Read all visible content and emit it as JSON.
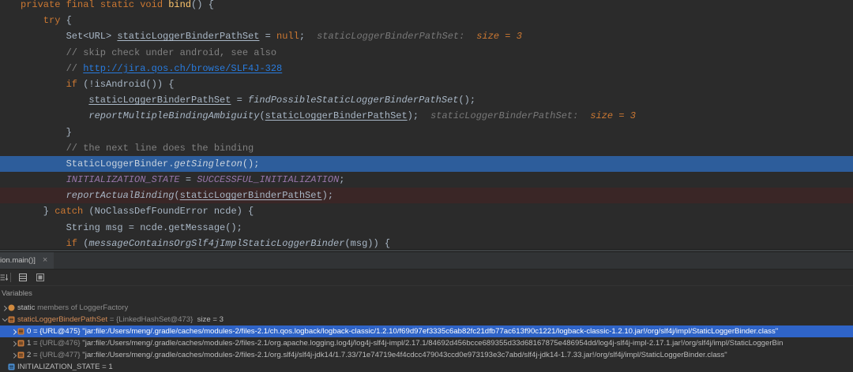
{
  "theme": {
    "editor_bg": "#2b2b2b",
    "execution_line_bg": "#2d5d9b",
    "breakpoint_line_bg": "#3a2626",
    "panel_bg": "#2b2b2b",
    "tabbar_bg": "#313335",
    "selection_bg": "#2f64c8"
  },
  "editor": {
    "lines": [
      {
        "indent": 0,
        "segs": [
          {
            "t": "private final static void ",
            "color": "#cc7832"
          },
          {
            "t": "bind",
            "color": "#ffc66d"
          },
          {
            "t": "() {",
            "color": "#a9b7c6"
          }
        ]
      },
      {
        "indent": 1,
        "segs": [
          {
            "t": "try",
            "color": "#cc7832"
          },
          {
            "t": " {",
            "color": "#a9b7c6"
          }
        ]
      },
      {
        "indent": 2,
        "segs": [
          {
            "t": "Set<URL> ",
            "color": "#a9b7c6"
          },
          {
            "t": "staticLoggerBinderPathSet",
            "color": "#a9b7c6",
            "underline": true
          },
          {
            "t": " = ",
            "color": "#a9b7c6"
          },
          {
            "t": "null",
            "color": "#cc7832"
          },
          {
            "t": ";",
            "color": "#a9b7c6"
          },
          {
            "t": "staticLoggerBinderPathSet:",
            "color": "#787878",
            "italic": true,
            "hint": true
          },
          {
            "t": "size = 3",
            "color": "#cc7832",
            "italic": true,
            "hint": true
          }
        ]
      },
      {
        "indent": 2,
        "segs": [
          {
            "t": "// skip check under android, see also",
            "color": "#808080"
          }
        ]
      },
      {
        "indent": 2,
        "segs": [
          {
            "t": "// ",
            "color": "#808080"
          },
          {
            "t": "http://jira.qos.ch/browse/SLF4J-328",
            "color": "#287bde",
            "underline": true,
            "link": true
          }
        ]
      },
      {
        "indent": 2,
        "segs": [
          {
            "t": "if",
            "color": "#cc7832"
          },
          {
            "t": " (!isAndroid()) {",
            "color": "#a9b7c6"
          }
        ]
      },
      {
        "indent": 3,
        "segs": [
          {
            "t": "staticLoggerBinderPathSet",
            "color": "#a9b7c6",
            "underline": true
          },
          {
            "t": " = ",
            "color": "#a9b7c6"
          },
          {
            "t": "findPossibleStaticLoggerBinderPathSet",
            "color": "#a9b7c6",
            "italic": true
          },
          {
            "t": "();",
            "color": "#a9b7c6"
          }
        ]
      },
      {
        "indent": 3,
        "segs": [
          {
            "t": "reportMultipleBindingAmbiguity",
            "color": "#a9b7c6",
            "italic": true
          },
          {
            "t": "(",
            "color": "#a9b7c6"
          },
          {
            "t": "staticLoggerBinderPathSet",
            "color": "#a9b7c6",
            "underline": true
          },
          {
            "t": ");",
            "color": "#a9b7c6"
          },
          {
            "t": "staticLoggerBinderPathSet:",
            "color": "#787878",
            "italic": true,
            "hint": true
          },
          {
            "t": "size = 3",
            "color": "#cc7832",
            "italic": true,
            "hint": true
          }
        ]
      },
      {
        "indent": 2,
        "segs": [
          {
            "t": "}",
            "color": "#a9b7c6"
          }
        ]
      },
      {
        "indent": 2,
        "segs": [
          {
            "t": "// the next line does the binding",
            "color": "#808080"
          }
        ]
      },
      {
        "indent": 2,
        "current_execution_line": true,
        "segs": [
          {
            "t": "StaticLoggerBinder.",
            "color": "#c9d3de"
          },
          {
            "t": "getSingleton",
            "color": "#c9d3de",
            "italic": true
          },
          {
            "t": "();",
            "color": "#c9d3de"
          }
        ]
      },
      {
        "indent": 2,
        "segs": [
          {
            "t": "INITIALIZATION_STATE",
            "color": "#9876aa",
            "italic": true
          },
          {
            "t": " = ",
            "color": "#a9b7c6"
          },
          {
            "t": "SUCCESSFUL_INITIALIZATION",
            "color": "#9876aa",
            "italic": true
          },
          {
            "t": ";",
            "color": "#a9b7c6"
          }
        ]
      },
      {
        "indent": 2,
        "breakpoint": true,
        "segs": [
          {
            "t": "reportActualBinding",
            "color": "#a9b7c6",
            "italic": true
          },
          {
            "t": "(",
            "color": "#a9b7c6"
          },
          {
            "t": "staticLoggerBinderPathSet",
            "color": "#a9b7c6",
            "underline": true
          },
          {
            "t": ");",
            "color": "#a9b7c6"
          }
        ]
      },
      {
        "indent": 1,
        "segs": [
          {
            "t": "} ",
            "color": "#a9b7c6"
          },
          {
            "t": "catch",
            "color": "#cc7832"
          },
          {
            "t": " (NoClassDefFoundError ncde) {",
            "color": "#a9b7c6"
          }
        ]
      },
      {
        "indent": 2,
        "segs": [
          {
            "t": "String msg = ncde.getMessage();",
            "color": "#a9b7c6"
          }
        ]
      },
      {
        "indent": 2,
        "segs": [
          {
            "t": "if",
            "color": "#cc7832"
          },
          {
            "t": " (",
            "color": "#a9b7c6"
          },
          {
            "t": "messageContainsOrgSlf4jImplStaticLoggerBinder",
            "color": "#a9b7c6",
            "italic": true
          },
          {
            "t": "(msg)) {",
            "color": "#a9b7c6"
          }
        ]
      }
    ]
  },
  "debugger": {
    "tab": {
      "label": "ion.main()]",
      "close": "×"
    },
    "toolbar_icons": [
      "restore-layout-icon",
      "table-view-icon",
      "panel-layout-icon"
    ],
    "variables_title": "Variables",
    "tree": [
      {
        "level": 0,
        "expandable": true,
        "expanded": false,
        "selected": false,
        "icon": "static-members-icon",
        "segs": [
          {
            "t": "static",
            "color": "#bbbbbb"
          },
          {
            "t": " members of LoggerFactory",
            "color": "#8c8c8c"
          }
        ]
      },
      {
        "level": 0,
        "expandable": true,
        "expanded": true,
        "selected": false,
        "icon": "field-icon",
        "segs": [
          {
            "t": "staticLoggerBinderPathSet",
            "color": "#d28b57"
          },
          {
            "t": " = {LinkedHashSet@473}",
            "color": "#8c8c8c"
          },
          {
            "t": "  size = 3",
            "color": "#bbbbbb"
          }
        ]
      },
      {
        "level": 1,
        "expandable": true,
        "expanded": false,
        "selected": true,
        "icon": "list-element-icon",
        "segs": [
          {
            "t": "0",
            "color": "#ffffff"
          },
          {
            "t": " = ",
            "color": "#ffffff"
          },
          {
            "t": "{URL@475} ",
            "color": "#ffffff"
          },
          {
            "t": "\"jar:file:/Users/meng/.gradle/caches/modules-2/files-2.1/ch.qos.logback/logback-classic/1.2.10/f69d97ef3335c6ab82fc21dfb77ac613f90c1221/logback-classic-1.2.10.jar!/org/slf4j/impl/StaticLoggerBinder.class\"",
            "color": "#ffffff"
          }
        ]
      },
      {
        "level": 1,
        "expandable": true,
        "expanded": false,
        "selected": false,
        "icon": "list-element-icon",
        "segs": [
          {
            "t": "1",
            "color": "#bbbbbb"
          },
          {
            "t": " = ",
            "color": "#bbbbbb"
          },
          {
            "t": "{URL@476} ",
            "color": "#8c8c8c"
          },
          {
            "t": "\"jar:file:/Users/meng/.gradle/caches/modules-2/files-2.1/org.apache.logging.log4j/log4j-slf4j-impl/2.17.1/84692d456bcce689355d33d68167875e486954dd/log4j-slf4j-impl-2.17.1.jar!/org/slf4j/impl/StaticLoggerBin",
            "color": "#bbbbbb"
          }
        ]
      },
      {
        "level": 1,
        "expandable": true,
        "expanded": false,
        "selected": false,
        "icon": "list-element-icon",
        "segs": [
          {
            "t": "2",
            "color": "#bbbbbb"
          },
          {
            "t": " = ",
            "color": "#bbbbbb"
          },
          {
            "t": "{URL@477} ",
            "color": "#8c8c8c"
          },
          {
            "t": "\"jar:file:/Users/meng/.gradle/caches/modules-2/files-2.1/org.slf4j/slf4j-jdk14/1.7.33/71e74719e4f4cdcc479043ccd0e973193e3c7abd/slf4j-jdk14-1.7.33.jar!/org/slf4j/impl/StaticLoggerBinder.class\"",
            "color": "#bbbbbb"
          }
        ]
      },
      {
        "level": 0,
        "expandable": false,
        "expanded": false,
        "selected": false,
        "icon": "primitive-field-icon",
        "segs": [
          {
            "t": "INITIALIZATION_STATE",
            "color": "#bbbbbb"
          },
          {
            "t": " = 1",
            "color": "#bbbbbb"
          }
        ]
      }
    ]
  }
}
